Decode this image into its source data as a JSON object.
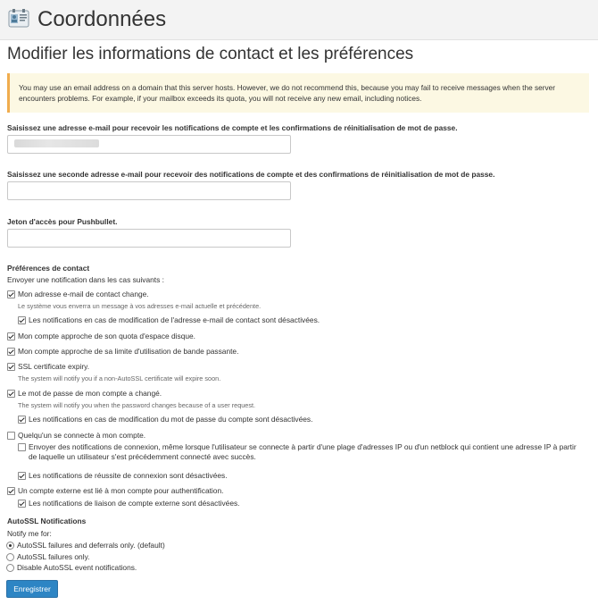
{
  "header": {
    "title": "Coordonnées",
    "icon": "contact-card-icon"
  },
  "page": {
    "subtitle": "Modifier les informations de contact et les préférences"
  },
  "alert": {
    "text": "You may use an email address on a domain that this server hosts. However, we do not recommend this, because you may fail to receive messages when the server encounters problems. For example, if your mailbox exceeds its quota, you will not receive any new email, including notices."
  },
  "form": {
    "email1_label": "Saisissez une adresse e-mail pour recevoir les notifications de compte et les confirmations de réinitialisation de mot de passe.",
    "email1_value": "",
    "email2_label": "Saisissez une seconde adresse e-mail pour recevoir des notifications de compte et des confirmations de réinitialisation de mot de passe.",
    "email2_value": "",
    "pushbullet_label": "Jeton d'accès pour Pushbullet.",
    "pushbullet_value": ""
  },
  "contact_prefs": {
    "title": "Préférences de contact",
    "intro": "Envoyer une notification dans les cas suivants :",
    "items": [
      {
        "label": "Mon adresse e-mail de contact change.",
        "checked": true
      },
      {
        "help": "Le système vous enverra un message à vos adresses e-mail actuelle et précédente."
      },
      {
        "label": "Les notifications en cas de modification de l'adresse e-mail de contact sont désactivées.",
        "checked": true
      },
      {
        "label": "Mon compte approche de son quota d'espace disque.",
        "checked": true
      },
      {
        "label": "Mon compte approche de sa limite d'utilisation de bande passante.",
        "checked": true
      },
      {
        "label": "SSL certificate expiry.",
        "checked": true
      },
      {
        "help": "The system will notify you if a non-AutoSSL certificate will expire soon."
      },
      {
        "label": "Le mot de passe de mon compte a changé.",
        "checked": true
      },
      {
        "help": "The system will notify you when the password changes because of a user request."
      },
      {
        "label": "Les notifications en cas de modification du mot de passe du compte sont désactivées.",
        "checked": true
      },
      {
        "label": "Quelqu'un se connecte à mon compte.",
        "checked": false
      },
      {
        "label": "Envoyer des notifications de connexion, même lorsque l'utilisateur se connecte à partir d'une plage d'adresses IP ou d'un netblock qui contient une adresse IP à partir de laquelle un utilisateur s'est précédemment connecté avec succès.",
        "checked": false
      },
      {
        "label": "Les notifications de réussite de connexion sont désactivées.",
        "checked": true
      },
      {
        "label": "Un compte externe est lié à mon compte pour authentification.",
        "checked": true
      },
      {
        "label": "Les notifications de liaison de compte externe sont désactivées.",
        "checked": true
      }
    ]
  },
  "autossl": {
    "title": "AutoSSL Notifications",
    "intro": "Notify me for:",
    "options": [
      {
        "label": "AutoSSL failures and deferrals only. (default)",
        "selected": true
      },
      {
        "label": "AutoSSL failures only.",
        "selected": false
      },
      {
        "label": "Disable AutoSSL event notifications.",
        "selected": false
      }
    ]
  },
  "actions": {
    "save_label": "Enregistrer"
  },
  "colors": {
    "button": "#2d85c4",
    "alert_background": "#fcf8e3",
    "alert_border": "#f0ad4e"
  }
}
